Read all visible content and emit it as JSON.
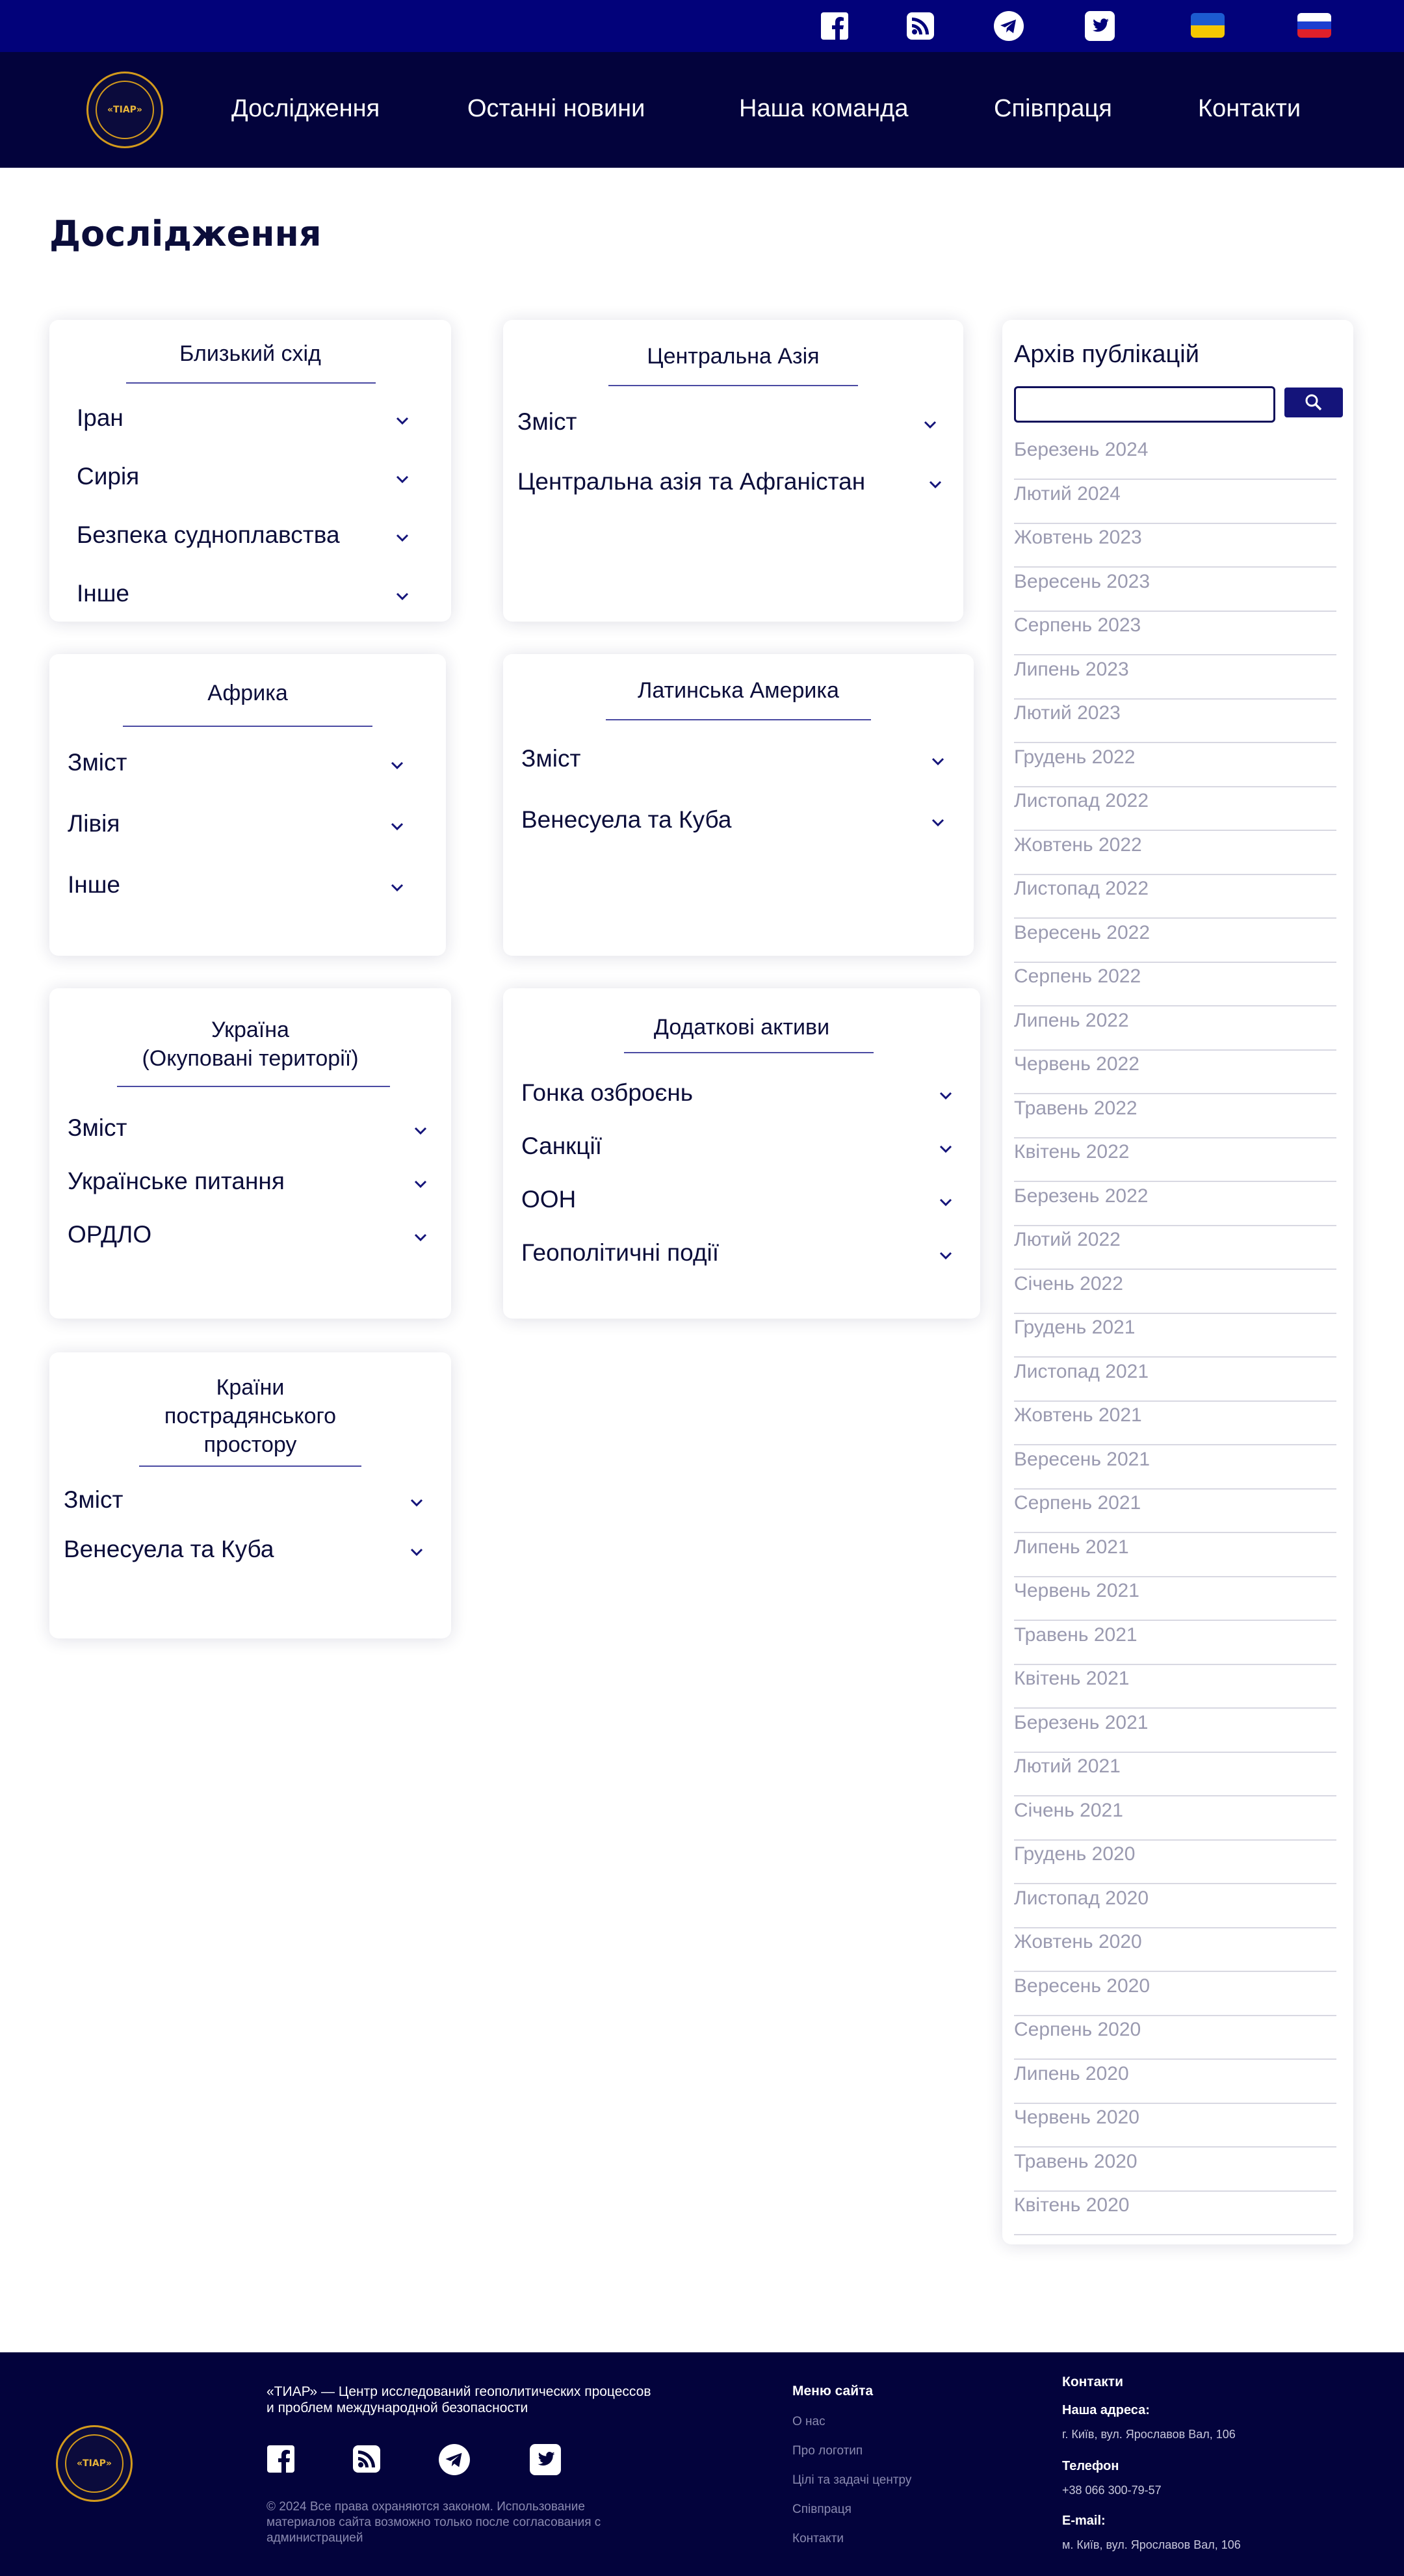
{
  "topbar": {
    "icons": [
      "facebook-icon",
      "rss-icon",
      "telegram-icon",
      "twitter-icon"
    ],
    "flags": [
      "ukraine-flag",
      "russia-flag"
    ]
  },
  "nav": {
    "logo_text": "«ТІАР»",
    "links": [
      "Дослідження",
      "Останні новини",
      "Наша команда",
      "Співпраця",
      "Контакти"
    ]
  },
  "page": {
    "title": "Дослідження"
  },
  "cards": {
    "middle_east": {
      "title": "Близький схід",
      "items": [
        "Іран",
        "Сирія",
        "Безпека судноплавства",
        "Інше"
      ]
    },
    "central_asia": {
      "title": "Центральна Азія",
      "items": [
        "Зміст",
        "Центральна азія та Афганістан"
      ]
    },
    "africa": {
      "title": "Африка",
      "items": [
        "Зміст",
        "Лівія",
        "Інше"
      ]
    },
    "latam": {
      "title": "Латинська Америка",
      "items": [
        "Зміст",
        "Венесуела та Куба"
      ]
    },
    "ukraine": {
      "title_line1": "Україна",
      "title_line2": "(Окуповані території)",
      "items": [
        "Зміст",
        "Українське питання",
        "ОРДЛО"
      ]
    },
    "extra": {
      "title": "Додаткові активи",
      "items": [
        "Гонка озброєнь",
        "Санкції",
        "ООН",
        "Геополітичні події"
      ]
    },
    "post_soviet": {
      "title_line1": "Країни",
      "title_line2": "пострадянського",
      "title_line3": "простору",
      "items": [
        "Зміст",
        "Венесуела та Куба"
      ]
    }
  },
  "archive": {
    "title": "Архів публікацій",
    "search_value": "",
    "items": [
      "Березень 2024",
      "Лютий 2024",
      "Жовтень 2023",
      "Вересень 2023",
      "Серпень 2023",
      "Липень 2023",
      "Лютий 2023",
      "Грудень 2022",
      "Листопад 2022",
      "Жовтень 2022",
      "Листопад 2022",
      "Вересень 2022",
      "Серпень 2022",
      "Липень 2022",
      "Червень 2022",
      "Травень 2022",
      "Квітень 2022",
      "Березень 2022",
      "Лютий 2022",
      "Січень 2022",
      "Грудень 2021",
      "Листопад 2021",
      "Жовтень 2021",
      "Вересень 2021",
      "Серпень 2021",
      "Липень 2021",
      "Червень 2021",
      "Травень 2021",
      "Квітень 2021",
      "Березень 2021",
      "Лютий 2021",
      "Січень 2021",
      "Грудень 2020",
      "Листопад 2020",
      "Жовтень 2020",
      "Вересень 2020",
      "Серпень 2020",
      "Липень 2020",
      "Червень 2020",
      "Травень 2020",
      "Квітень 2020"
    ]
  },
  "footer": {
    "logo_text": "«ТІАР»",
    "about": "«ТИАР» — Центр исследований геополитических процессов и проблем международной безопасности",
    "copyright": "© 2024 Все права охраняются законом. Использование материалов сайта возможно только после согласования с администрацией",
    "menu_title": "Меню сайта",
    "menu_items": [
      "О нас",
      "Про логотип",
      "Цілі та задачі центру",
      "Співпраця",
      "Контакти"
    ],
    "contacts_title": "Контакти",
    "address_label": "Наша адреса:",
    "address": "г. Київ, вул. Ярославов Вал, 106",
    "phone_label": "Телефон",
    "phone": "+38 066 300-79-57",
    "email_label": "E-mail:",
    "email": "м. Київ, вул. Ярославов Вал, 106"
  },
  "colors": {
    "topbar": "#02027a",
    "nav": "#03033c",
    "accent": "#14147a",
    "gold": "#d39a1c"
  }
}
